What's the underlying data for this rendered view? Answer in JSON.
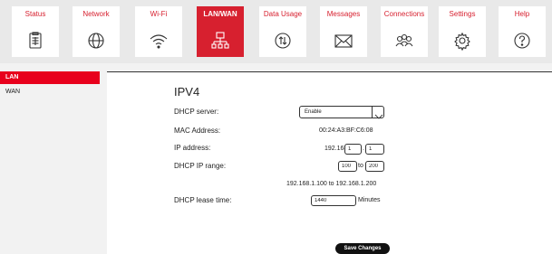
{
  "nav": [
    {
      "label": "Status",
      "icon": "clipboard-icon"
    },
    {
      "label": "Network",
      "icon": "globe-icon"
    },
    {
      "label": "Wi-Fi",
      "icon": "wifi-icon"
    },
    {
      "label": "LAN/WAN",
      "icon": "network-tree-icon"
    },
    {
      "label": "Data Usage",
      "icon": "data-usage-icon"
    },
    {
      "label": "Messages",
      "icon": "envelope-icon"
    },
    {
      "label": "Connections",
      "icon": "users-icon"
    },
    {
      "label": "Settings",
      "icon": "gear-icon"
    },
    {
      "label": "Help",
      "icon": "question-icon"
    }
  ],
  "sidebar": {
    "items": [
      {
        "label": "LAN"
      },
      {
        "label": "WAN"
      }
    ]
  },
  "main": {
    "title": "IPV4",
    "dhcp_server_label": "DHCP server:",
    "dhcp_server_value": "Enable",
    "mac_label": "MAC Address:",
    "mac_value": "00:24:A3:BF:C6:08",
    "ip_label": "IP address:",
    "ip_prefix": "192.168.",
    "ip_octet3": "1",
    "ip_sep": ".",
    "ip_octet4": "1",
    "range_label": "DHCP IP range:",
    "range_start": "100",
    "range_to": "to",
    "range_end": "200",
    "range_summary": "192.168.1.100 to 192.168.1.200",
    "lease_label": "DHCP lease time:",
    "lease_value": "1440",
    "lease_unit": "Minutes",
    "save_label": "Save Changes"
  },
  "colors": {
    "accent": "#d7202f",
    "sidebar_active": "#e8001c",
    "button": "#111111"
  }
}
